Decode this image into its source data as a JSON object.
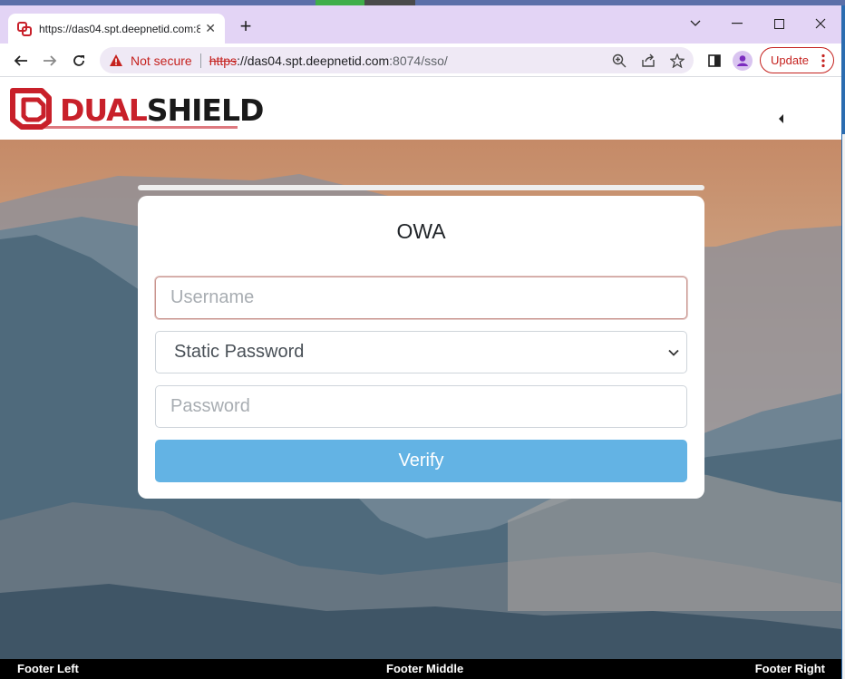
{
  "browser": {
    "tab_title": "https://das04.spt.deepnetid.com:8074/sso/",
    "new_tab_icon": "plus-icon",
    "address": {
      "security_label": "Not secure",
      "scheme": "https",
      "host": "://das04.spt.deepnetid.com",
      "rest": ":8074/sso/"
    },
    "update_label": "Update"
  },
  "header": {
    "logo_red": "DUAL",
    "logo_dark": "SHIELD"
  },
  "login": {
    "title": "OWA",
    "username_placeholder": "Username",
    "auth_method": "Static Password",
    "password_placeholder": "Password",
    "verify_label": "Verify"
  },
  "footer": {
    "left": "Footer Left",
    "middle": "Footer Middle",
    "right": "Footer Right"
  },
  "colors": {
    "accent_red": "#c8202a",
    "verify_blue": "#63b3e4",
    "tabstrip": "#e3d4f5"
  }
}
